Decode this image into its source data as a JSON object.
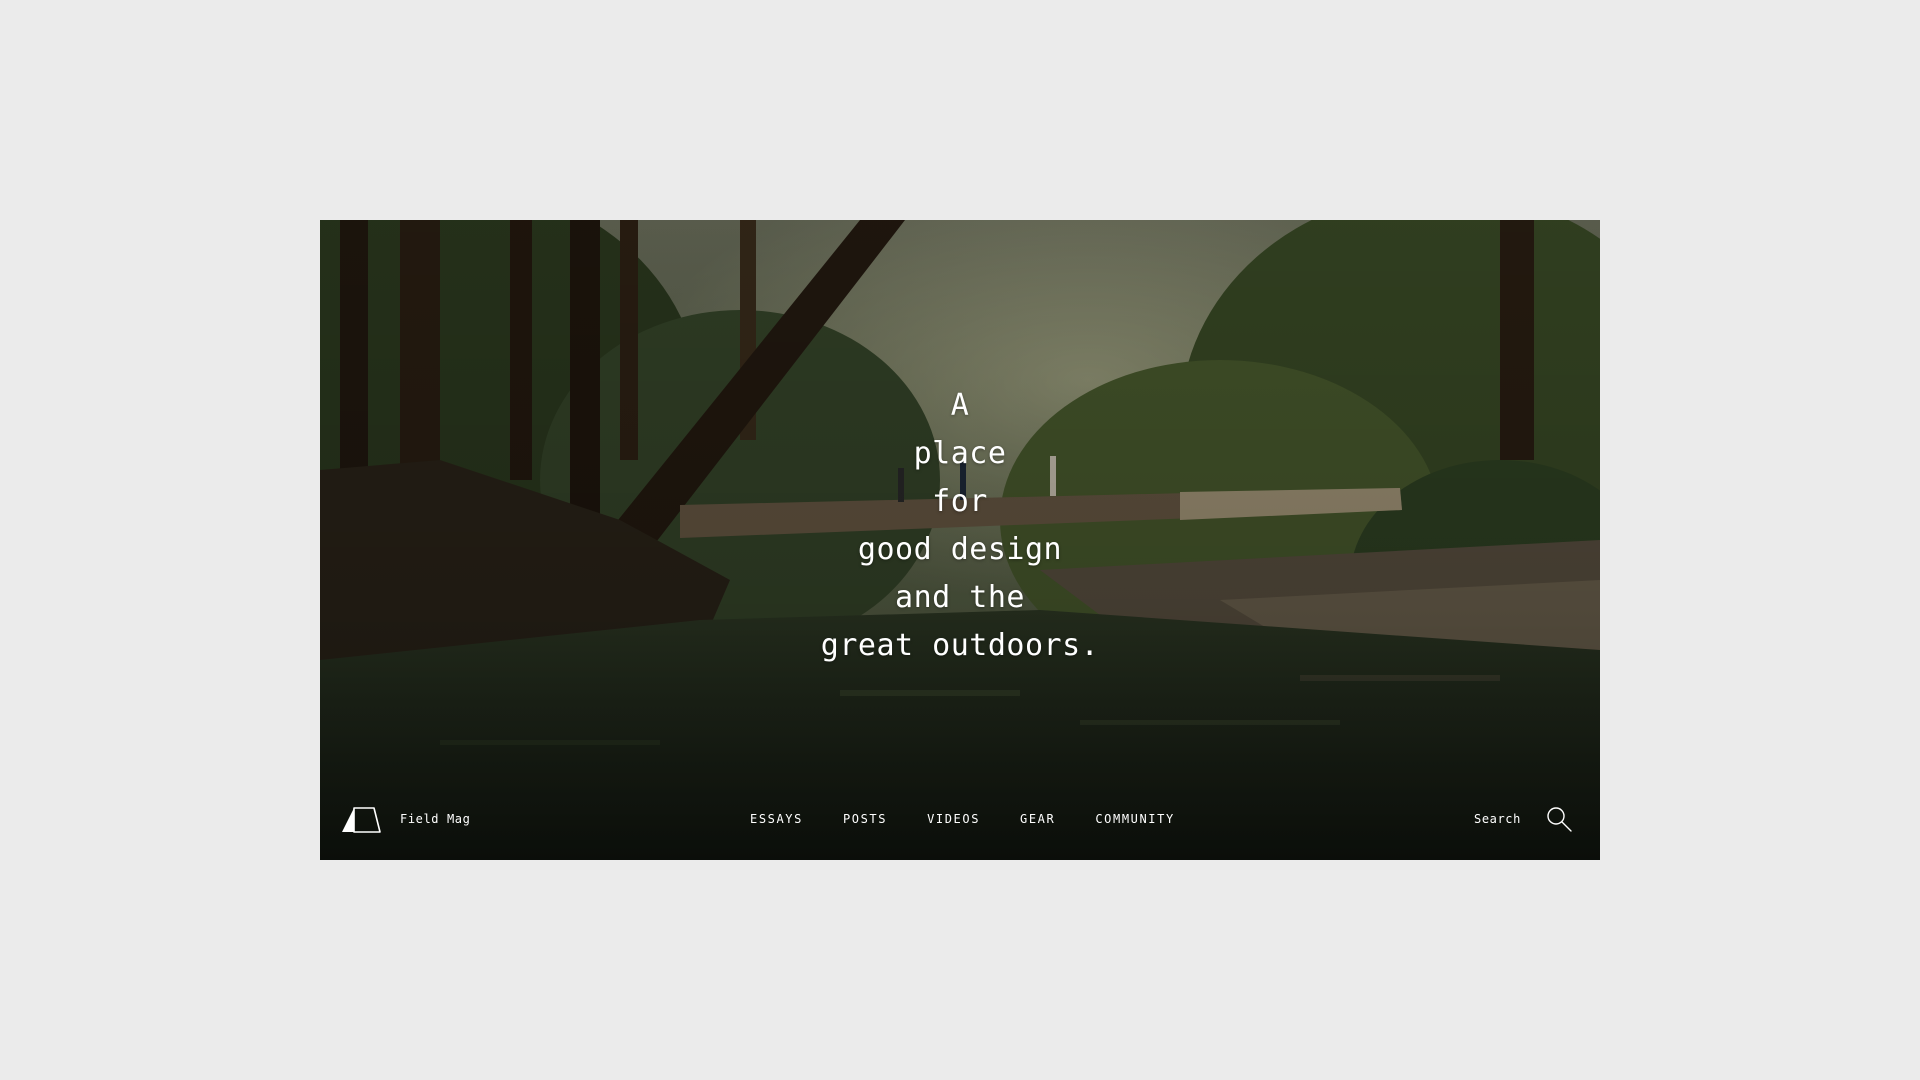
{
  "hero": {
    "headline_lines": [
      "A",
      "place",
      "for",
      "good design",
      "and the",
      "great outdoors."
    ]
  },
  "brand": {
    "name": "Field Mag",
    "logo_icon": "tent-logo-icon"
  },
  "nav": {
    "items": [
      "ESSAYS",
      "POSTS",
      "VIDEOS",
      "GEAR",
      "COMMUNITY"
    ]
  },
  "search": {
    "label": "Search",
    "icon": "search-icon"
  },
  "colors": {
    "page_background": "#ebebeb",
    "text": "#ffffff"
  }
}
